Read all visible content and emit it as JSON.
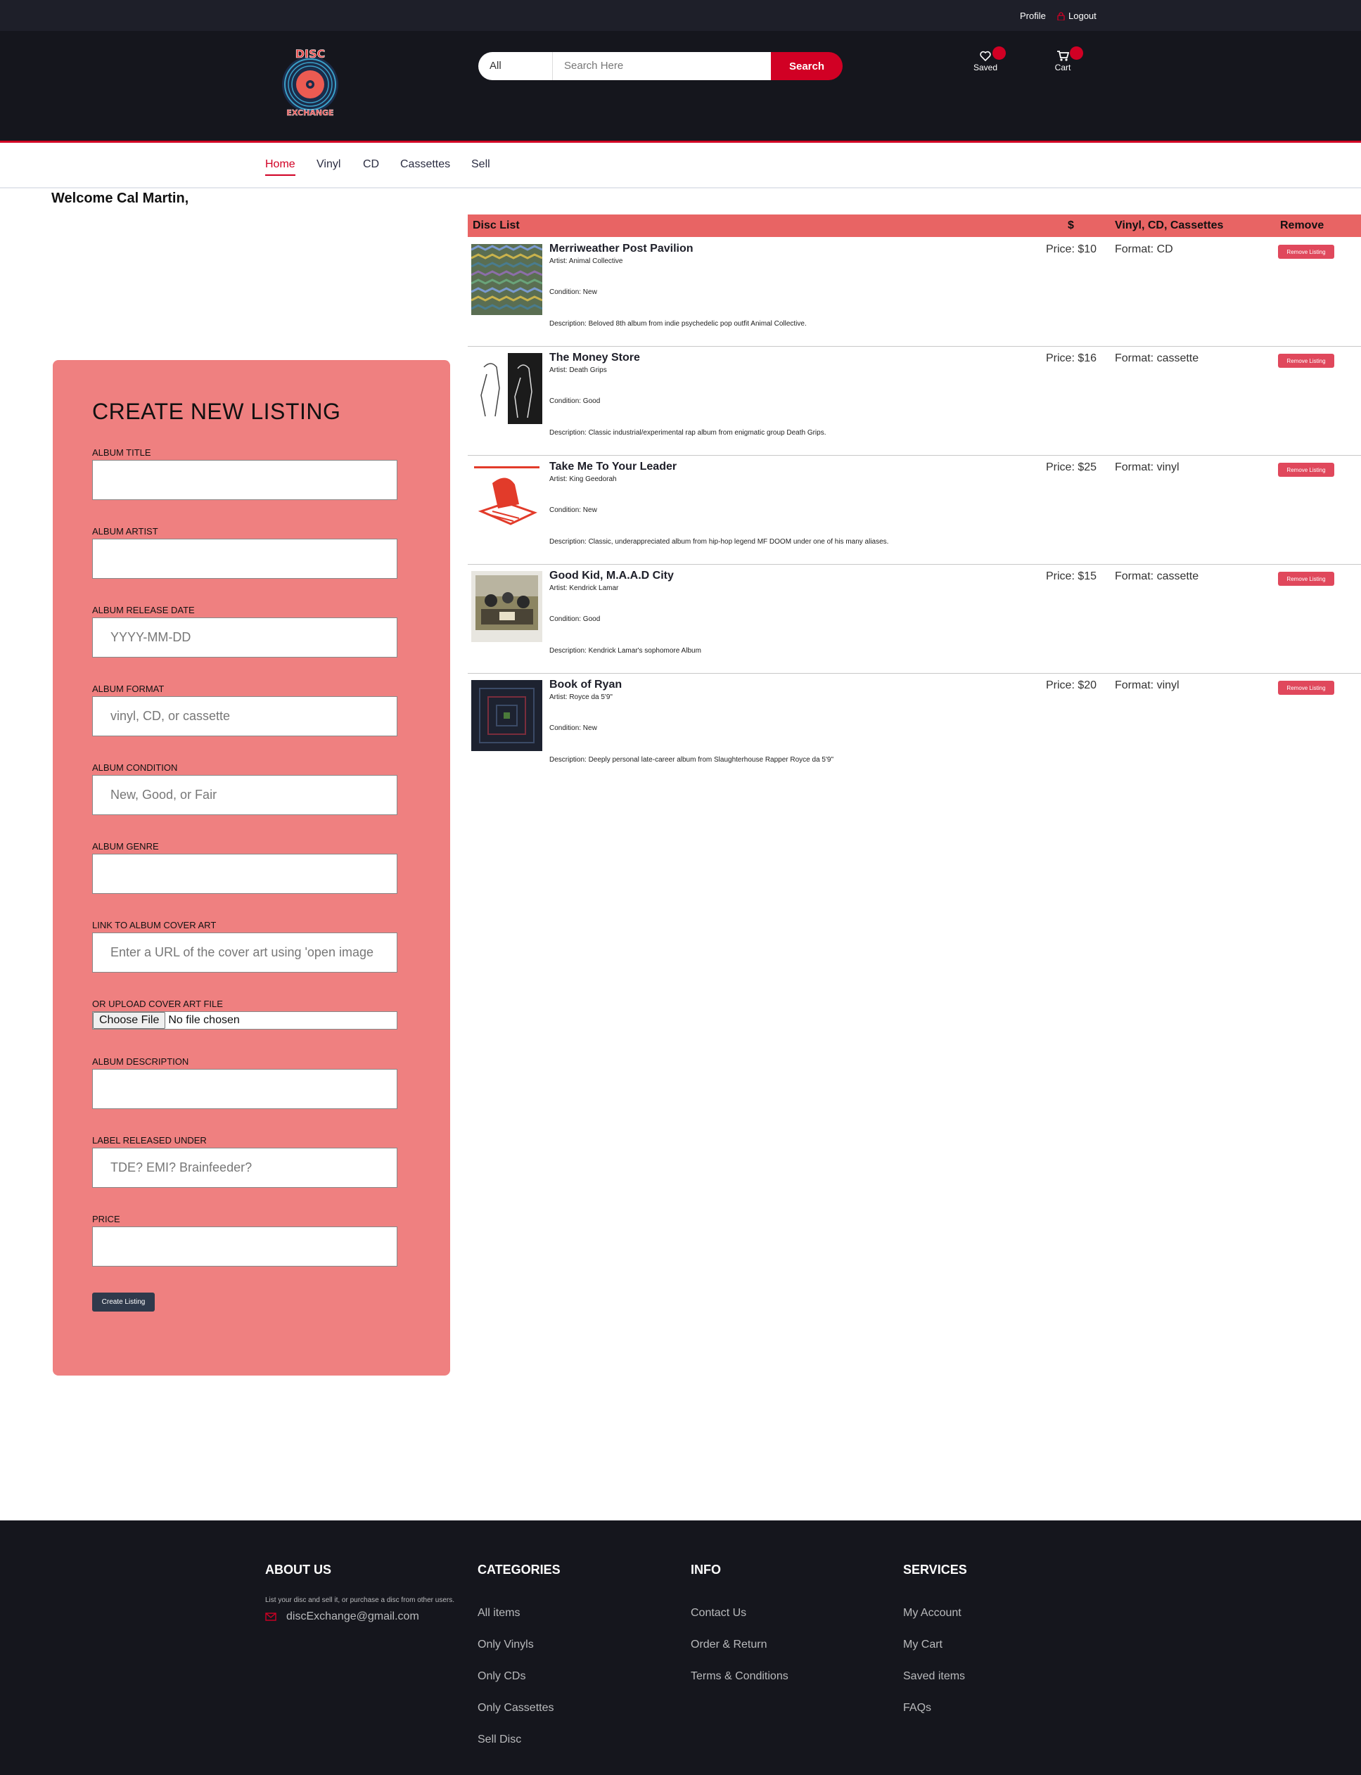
{
  "topbar": {
    "profile": "Profile",
    "logout": "Logout"
  },
  "logo": {
    "top_text": "DISC",
    "bottom_text": "EXCHANGE"
  },
  "search": {
    "category": "All",
    "placeholder": "Search Here",
    "button": "Search"
  },
  "header_icons": {
    "saved": "Saved",
    "cart": "Cart"
  },
  "nav": [
    "Home",
    "Vinyl",
    "CD",
    "Cassettes",
    "Sell"
  ],
  "welcome": "Welcome Cal Martin,",
  "form": {
    "heading": "CREATE NEW LISTING",
    "fields": [
      {
        "label": "ALBUM TITLE",
        "placeholder": ""
      },
      {
        "label": "ALBUM ARTIST",
        "placeholder": ""
      },
      {
        "label": "ALBUM RELEASE DATE",
        "placeholder": "YYYY-MM-DD"
      },
      {
        "label": "ALBUM FORMAT",
        "placeholder": "vinyl, CD, or cassette"
      },
      {
        "label": "ALBUM CONDITION",
        "placeholder": "New, Good, or Fair"
      },
      {
        "label": "ALBUM GENRE",
        "placeholder": ""
      },
      {
        "label": "LINK TO ALBUM COVER ART",
        "placeholder": "Enter a URL of the cover art using 'open image"
      }
    ],
    "upload": {
      "label": "OR UPLOAD COVER ART FILE",
      "button": "Choose File",
      "status": "No file chosen"
    },
    "fields2": [
      {
        "label": "ALBUM DESCRIPTION",
        "placeholder": ""
      },
      {
        "label": "LABEL RELEASED UNDER",
        "placeholder": "TDE? EMI? Brainfeeder?"
      },
      {
        "label": "PRICE",
        "placeholder": ""
      }
    ],
    "submit": "Create Listing"
  },
  "disc_list": {
    "headers": {
      "list": "Disc List",
      "price": "$",
      "format": "Vinyl, CD, Cassettes",
      "remove": "Remove"
    },
    "items": [
      {
        "title": "Merriweather Post Pavilion",
        "artist": "Artist: Animal Collective",
        "condition": "Condition: New",
        "description": "Description: Beloved 8th album from indie psychedelic pop outfit Animal Collective.",
        "price": "Price: $10",
        "format": "Format: CD",
        "remove": "Remove Listing",
        "cover_icon": "mosaic-cover"
      },
      {
        "title": "The Money Store",
        "artist": "Artist: Death Grips",
        "condition": "Condition: Good",
        "description": "Description: Classic industrial/experimental rap album from enigmatic group Death Grips.",
        "price": "Price: $16",
        "format": "Format: cassette",
        "remove": "Remove Listing",
        "cover_icon": "sketch-cover"
      },
      {
        "title": "Take Me To Your Leader",
        "artist": "Artist: King Geedorah",
        "condition": "Condition: New",
        "description": "Description: Classic, underappreciated album from hip-hop legend MF DOOM under one of his many aliases.",
        "price": "Price: $25",
        "format": "Format: vinyl",
        "remove": "Remove Listing",
        "cover_icon": "red-monster-cover"
      },
      {
        "title": "Good Kid, M.A.A.D City",
        "artist": "Artist: Kendrick Lamar",
        "condition": "Condition: Good",
        "description": "Description: Kendrick Lamar's sophomore Album",
        "price": "Price: $15",
        "format": "Format: cassette",
        "remove": "Remove Listing",
        "cover_icon": "photo-cover"
      },
      {
        "title": "Book of Ryan",
        "artist": "Artist: Royce da 5'9\"",
        "condition": "Condition: New",
        "description": "Description: Deeply personal late-career album from Slaughterhouse Rapper Royce da 5'9\"",
        "price": "Price: $20",
        "format": "Format: vinyl",
        "remove": "Remove Listing",
        "cover_icon": "dark-book-cover"
      }
    ]
  },
  "footer": {
    "about": {
      "title": "ABOUT US",
      "text": "List your disc and sell it, or purchase a disc from other users.",
      "email": "discExchange@gmail.com"
    },
    "categories": {
      "title": "CATEGORIES",
      "links": [
        "All items",
        "Only Vinyls",
        "Only CDs",
        "Only Cassettes",
        "Sell Disc"
      ]
    },
    "info": {
      "title": "INFO",
      "links": [
        "Contact Us",
        "Order & Return",
        "Terms & Conditions"
      ]
    },
    "services": {
      "title": "SERVICES",
      "links": [
        "My Account",
        "My Cart",
        "Saved items",
        "FAQs"
      ]
    }
  },
  "colors": {
    "accent": "#d10024",
    "header_bg": "#15161d",
    "panel_bg": "#ef8080",
    "list_header_bg": "#e86464"
  }
}
